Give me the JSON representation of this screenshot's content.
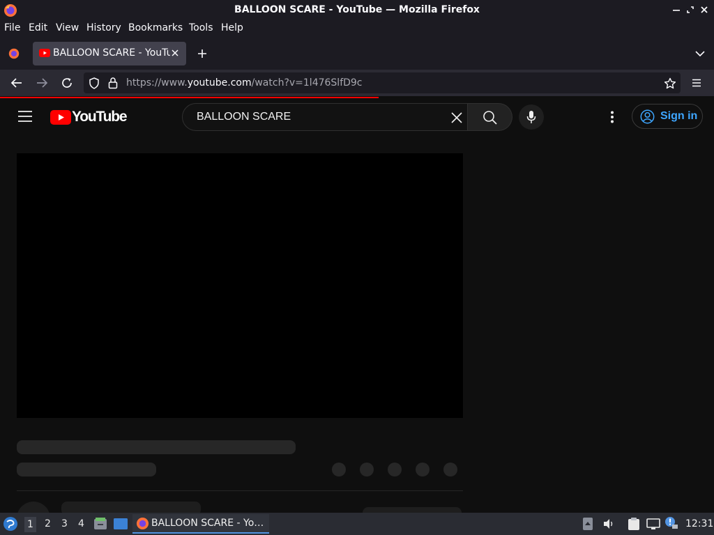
{
  "window": {
    "title": "BALLOON SCARE - YouTube — Mozilla Firefox"
  },
  "menu": [
    "File",
    "Edit",
    "View",
    "History",
    "Bookmarks",
    "Tools",
    "Help"
  ],
  "tab": {
    "label": "BALLOON SCARE - YouTube"
  },
  "urlbar": {
    "prefix": "https://www.",
    "host": "youtube.com",
    "path": "/watch?v=1l476SlfD9c"
  },
  "loading_progress": 0.53,
  "youtube": {
    "logo_text": "YouTube",
    "search_value": "BALLOON SCARE",
    "signin_label": "Sign in"
  },
  "taskbar": {
    "workspaces": [
      "1",
      "2",
      "3",
      "4"
    ],
    "active_workspace": "1",
    "task_label": "BALLOON SCARE - Yo…",
    "clock": "12:31"
  },
  "colors": {
    "yt_red": "#ff0000",
    "signin_blue": "#3ea6ff",
    "background": "#0f0f0f"
  }
}
